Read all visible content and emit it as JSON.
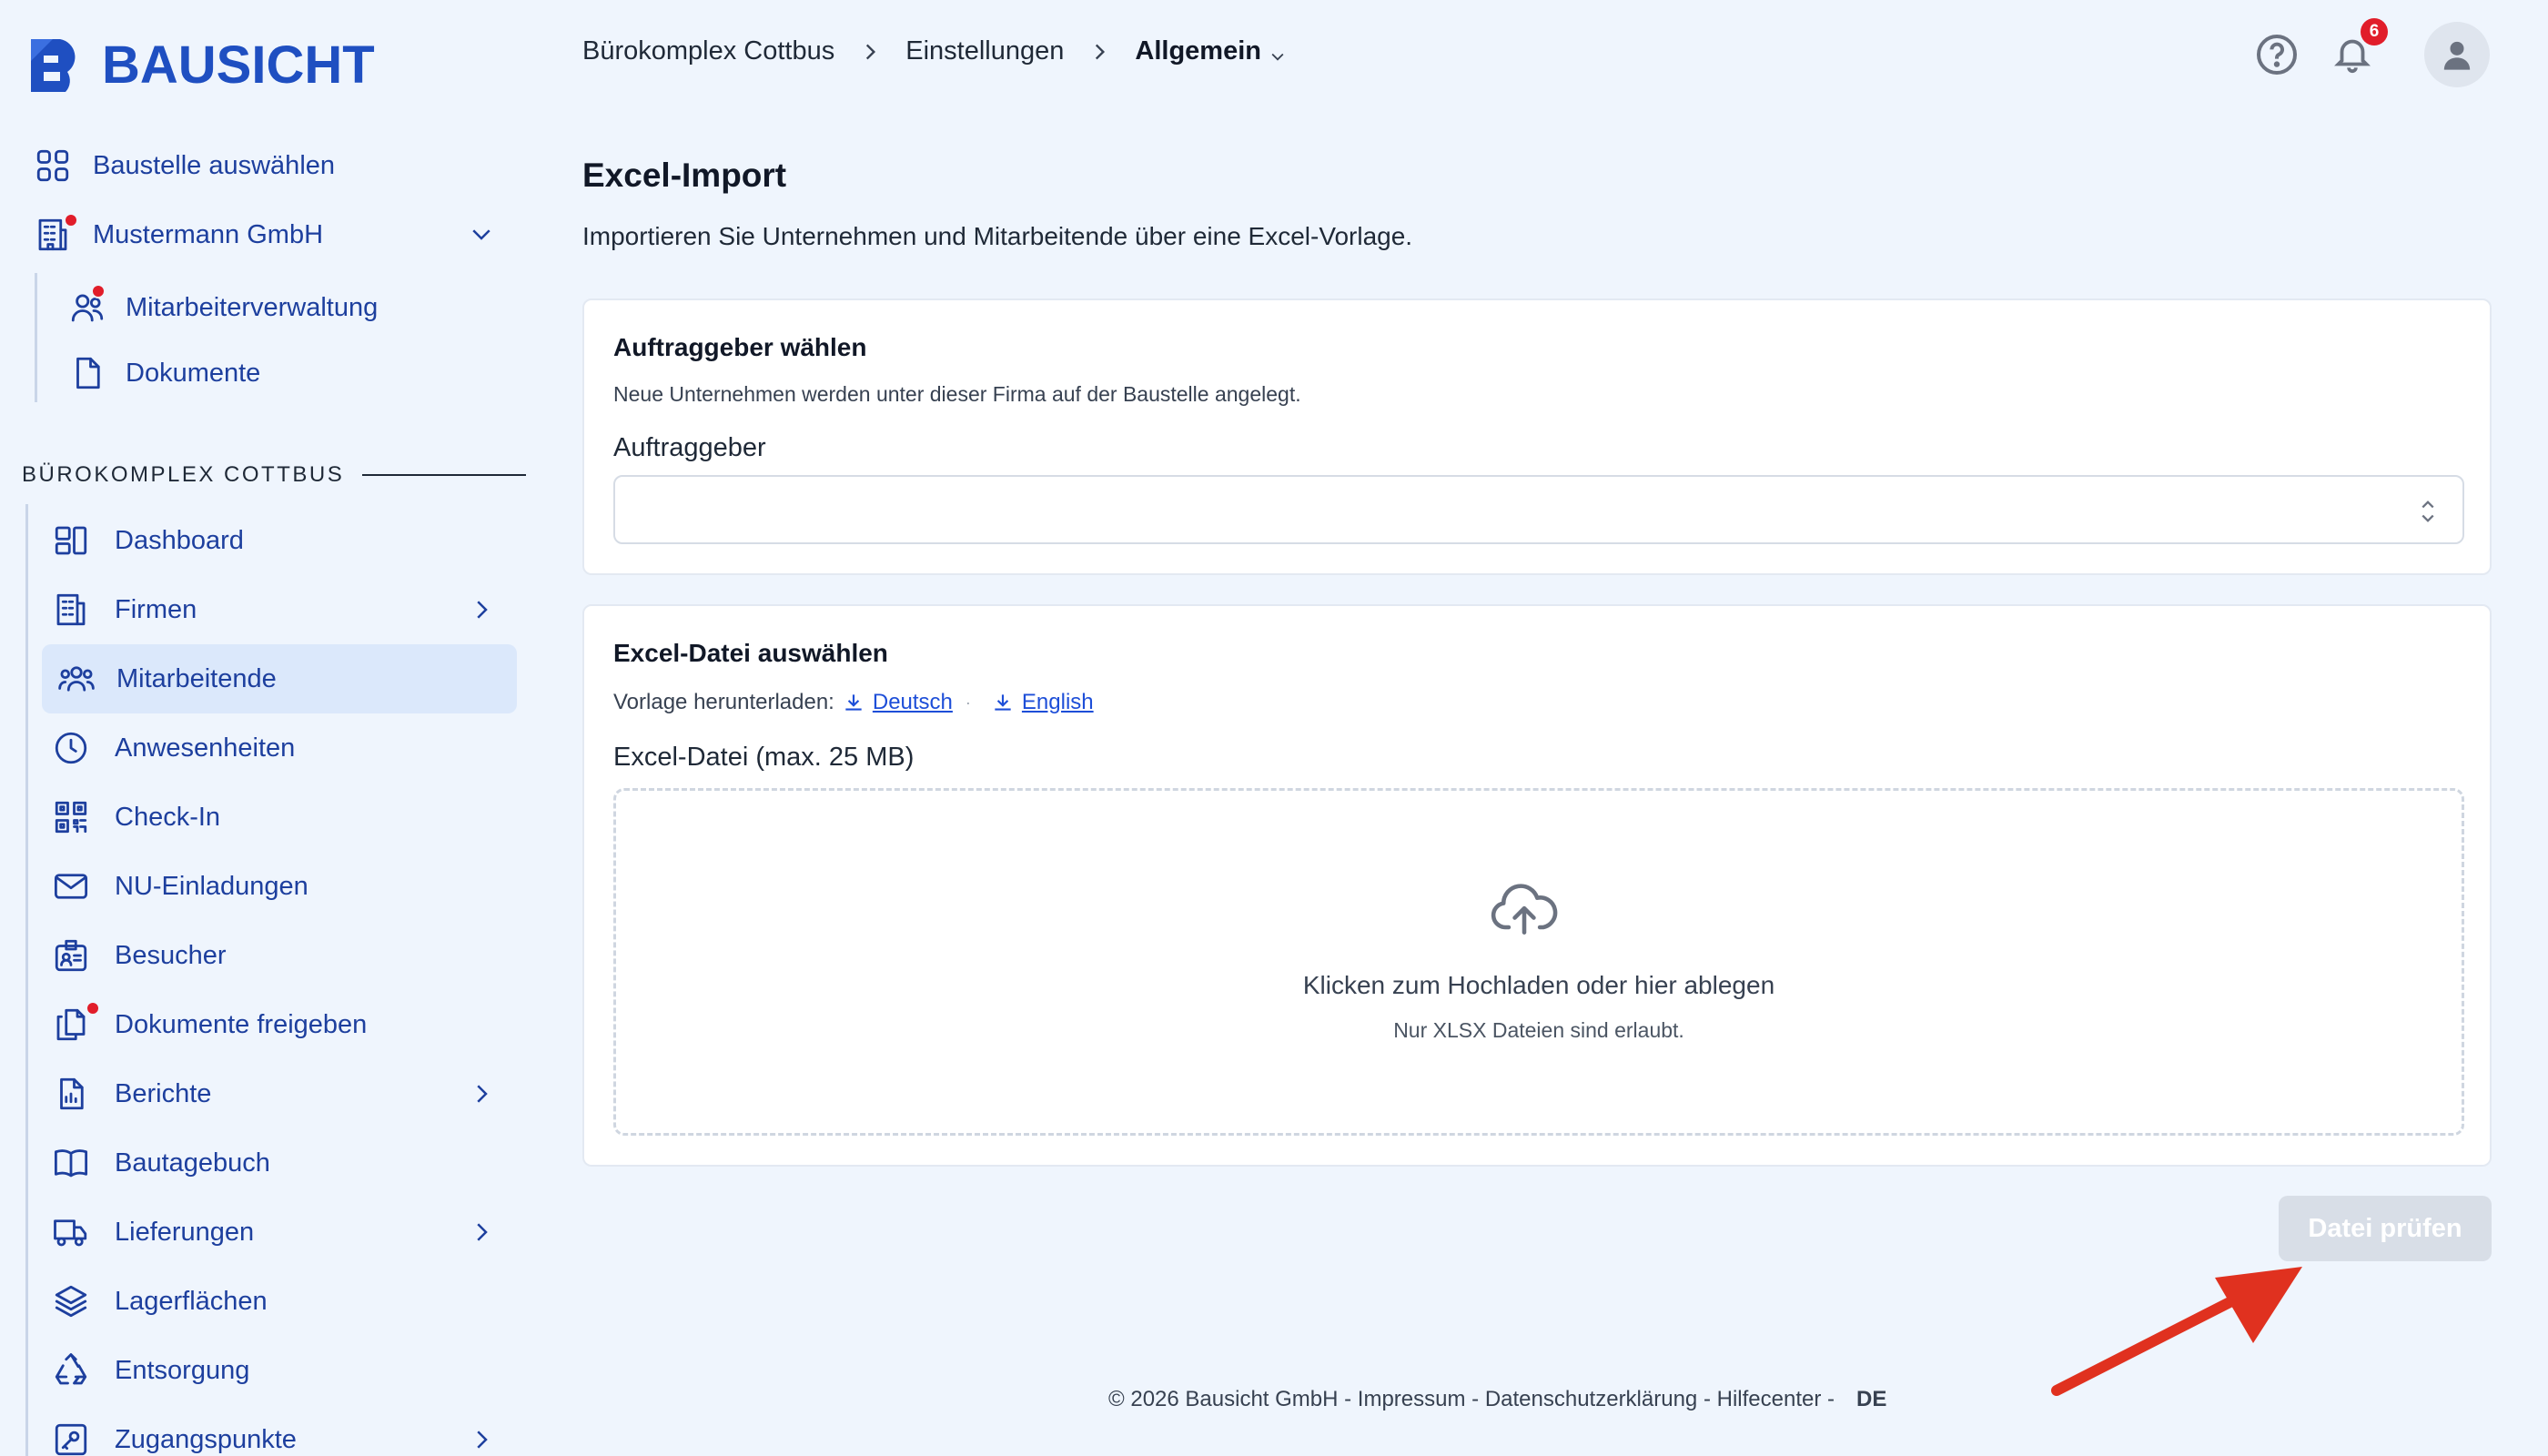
{
  "brand": {
    "name": "BAUSICHT",
    "color": "#1f4fc1"
  },
  "sidebar": {
    "top_items": [
      {
        "label": "Baustelle auswählen",
        "icon": "grid-icon"
      },
      {
        "label": "Mustermann GmbH",
        "icon": "building-icon",
        "has_dot": true,
        "expandable": true
      },
      {
        "label": "Mitarbeiterverwaltung",
        "icon": "users-icon",
        "has_dot": true
      },
      {
        "label": "Dokumente",
        "icon": "document-icon"
      }
    ],
    "section_title": "BÜROKOMPLEX COTTBUS",
    "items": [
      {
        "label": "Dashboard",
        "icon": "dashboard-icon"
      },
      {
        "label": "Firmen",
        "icon": "building-icon",
        "chevron": true
      },
      {
        "label": "Mitarbeitende",
        "icon": "users-group-icon",
        "active": true
      },
      {
        "label": "Anwesenheiten",
        "icon": "clock-icon"
      },
      {
        "label": "Check-In",
        "icon": "qr-code-icon"
      },
      {
        "label": "NU-Einladungen",
        "icon": "mail-icon"
      },
      {
        "label": "Besucher",
        "icon": "id-badge-icon"
      },
      {
        "label": "Dokumente freigeben",
        "icon": "documents-icon",
        "has_dot": true
      },
      {
        "label": "Berichte",
        "icon": "report-icon",
        "chevron": true
      },
      {
        "label": "Bautagebuch",
        "icon": "book-icon"
      },
      {
        "label": "Lieferungen",
        "icon": "truck-icon",
        "chevron": true
      },
      {
        "label": "Lagerflächen",
        "icon": "layers-icon"
      },
      {
        "label": "Entsorgung",
        "icon": "recycle-icon"
      },
      {
        "label": "Zugangspunkte",
        "icon": "key-icon",
        "chevron": true
      }
    ]
  },
  "header": {
    "breadcrumb": [
      "Bürokomplex Cottbus",
      "Einstellungen",
      "Allgemein"
    ],
    "notification_count": "6"
  },
  "main": {
    "title": "Excel-Import",
    "subtitle": "Importieren Sie Unternehmen und Mitarbeitende über eine Excel-Vorlage.",
    "client_card": {
      "heading": "Auftraggeber wählen",
      "help": "Neue Unternehmen werden unter dieser Firma auf der Baustelle angelegt.",
      "field_label": "Auftraggeber",
      "value": ""
    },
    "file_card": {
      "heading": "Excel-Datei auswählen",
      "download_label": "Vorlage herunterladen:",
      "download_links": [
        "Deutsch",
        "English"
      ],
      "field_label": "Excel-Datei (max. 25 MB)",
      "dropzone_title": "Klicken zum Hochladen oder hier ablegen",
      "dropzone_hint": "Nur XLSX Dateien sind erlaubt."
    },
    "submit_label": "Datei prüfen"
  },
  "footer": {
    "copyright": "© 2026 Bausicht GmbH",
    "links": [
      "Impressum",
      "Datenschutzerklärung",
      "Hilfecenter"
    ],
    "language": "DE"
  },
  "colors": {
    "nav_text": "#1d3f9e",
    "active_bg": "#dbe8fb",
    "badge": "#e11d2a",
    "annotation_arrow": "#e0311f"
  }
}
